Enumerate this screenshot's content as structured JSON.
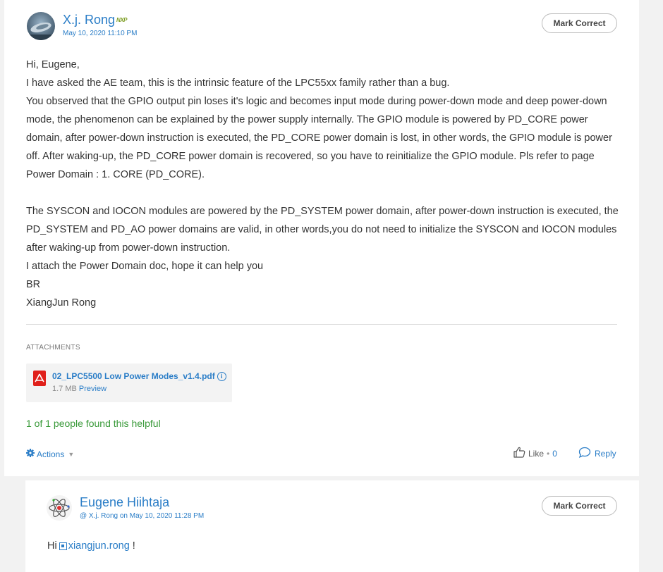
{
  "post": {
    "author": "X.j. Rong",
    "badge": "NXP",
    "date": "May 10, 2020 11:10 PM",
    "mark_correct": "Mark Correct",
    "paragraphs": [
      "Hi, Eugene,",
      "I have asked the AE team, this is the intrinsic  feature of the LPC55xx family rather than a bug.",
      "You observed that the GPIO output pin loses  it's logic and becomes input mode during power-down mode and deep power-down mode, the phenomenon can be explained by the power supply internally.  The GPIO module is powered by PD_CORE power domain, after power-down instruction is executed, the PD_CORE power domain is lost, in other words, the GPIO module is power off. After waking-up, the PD_CORE power domain is recovered, so you have to reinitialize the GPIO module. Pls refer to page Power Domain : 1. CORE (PD_CORE).",
      "",
      "The SYSCON and IOCON modules are powered by the PD_SYSTEM power domain, after power-down instruction is executed, the PD_SYSTEM and PD_AO power domains are valid, in other words,you do not need to initialize the SYSCON and IOCON modules after waking-up from power-down instruction.",
      "I attach the Power Domain doc, hope it can help you",
      "BR",
      "XiangJun Rong"
    ],
    "attachments_label": "ATTACHMENTS",
    "attachment": {
      "name": "02_LPC5500 Low Power Modes_v1.4.pdf",
      "size": "1.7 MB",
      "preview": "Preview"
    },
    "helpful": "1 of 1 people found this helpful",
    "actions_label": "Actions",
    "like_label": "Like",
    "like_separator": "•",
    "like_count": "0",
    "reply_label": "Reply"
  },
  "reply_post": {
    "author": "Eugene Hiihtaja",
    "meta": "@ X.j. Rong on May 10, 2020 11:28 PM",
    "mark_correct": "Mark Correct",
    "greeting": "Hi",
    "mention": "xiangjun.rong",
    "suffix": " !"
  },
  "icons": {
    "actions": "gear-icon",
    "like": "thumbs-up-icon",
    "reply": "speech-bubble-icon",
    "attachment": "pdf-icon",
    "info": "info-icon",
    "mention": "user-mention-icon"
  },
  "colors": {
    "link": "#2a7dc7",
    "helpful": "#3a9a3a",
    "pdf": "#e0201b"
  }
}
